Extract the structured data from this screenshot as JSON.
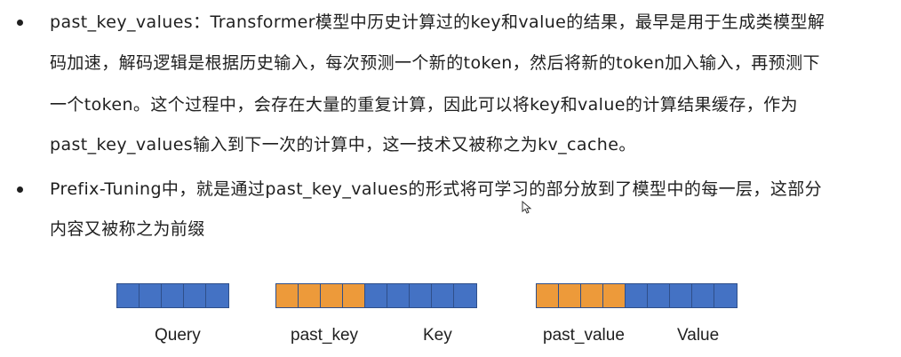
{
  "bullets": [
    {
      "lines": [
        "past_key_values：Transformer模型中历史计算过的key和value的结果，最早是用于生成类模型解",
        "码加速，解码逻辑是根据历史输入，每次预测一个新的token，然后将新的token加入输入，再预测下",
        "一个token。这个过程中，会存在大量的重复计算，因此可以将key和value的计算结果缓存，作为",
        "past_key_values输入到下一次的计算中，这一技术又被称之为kv_cache。"
      ]
    },
    {
      "lines": [
        "Prefix-Tuning中，就是通过past_key_values的形式将可学习的部分放到了模型中的每一层，这部分",
        "内容又被称之为前缀"
      ]
    }
  ],
  "diagram": {
    "labels": {
      "query": "Query",
      "past_key": "past_key",
      "key": "Key",
      "past_value": "past_value",
      "value": "Value"
    },
    "colors": {
      "learned_prefix": "#ed9a3a",
      "regular": "#4472c4"
    },
    "strips": [
      {
        "name": "query",
        "segments": [
          "blue",
          "blue",
          "blue",
          "blue",
          "blue"
        ]
      },
      {
        "name": "key",
        "segments": [
          "orange",
          "orange",
          "orange",
          "orange",
          "blue",
          "blue",
          "blue",
          "blue",
          "blue"
        ]
      },
      {
        "name": "value",
        "segments": [
          "orange",
          "orange",
          "orange",
          "orange",
          "blue",
          "blue",
          "blue",
          "blue",
          "blue"
        ]
      }
    ]
  }
}
